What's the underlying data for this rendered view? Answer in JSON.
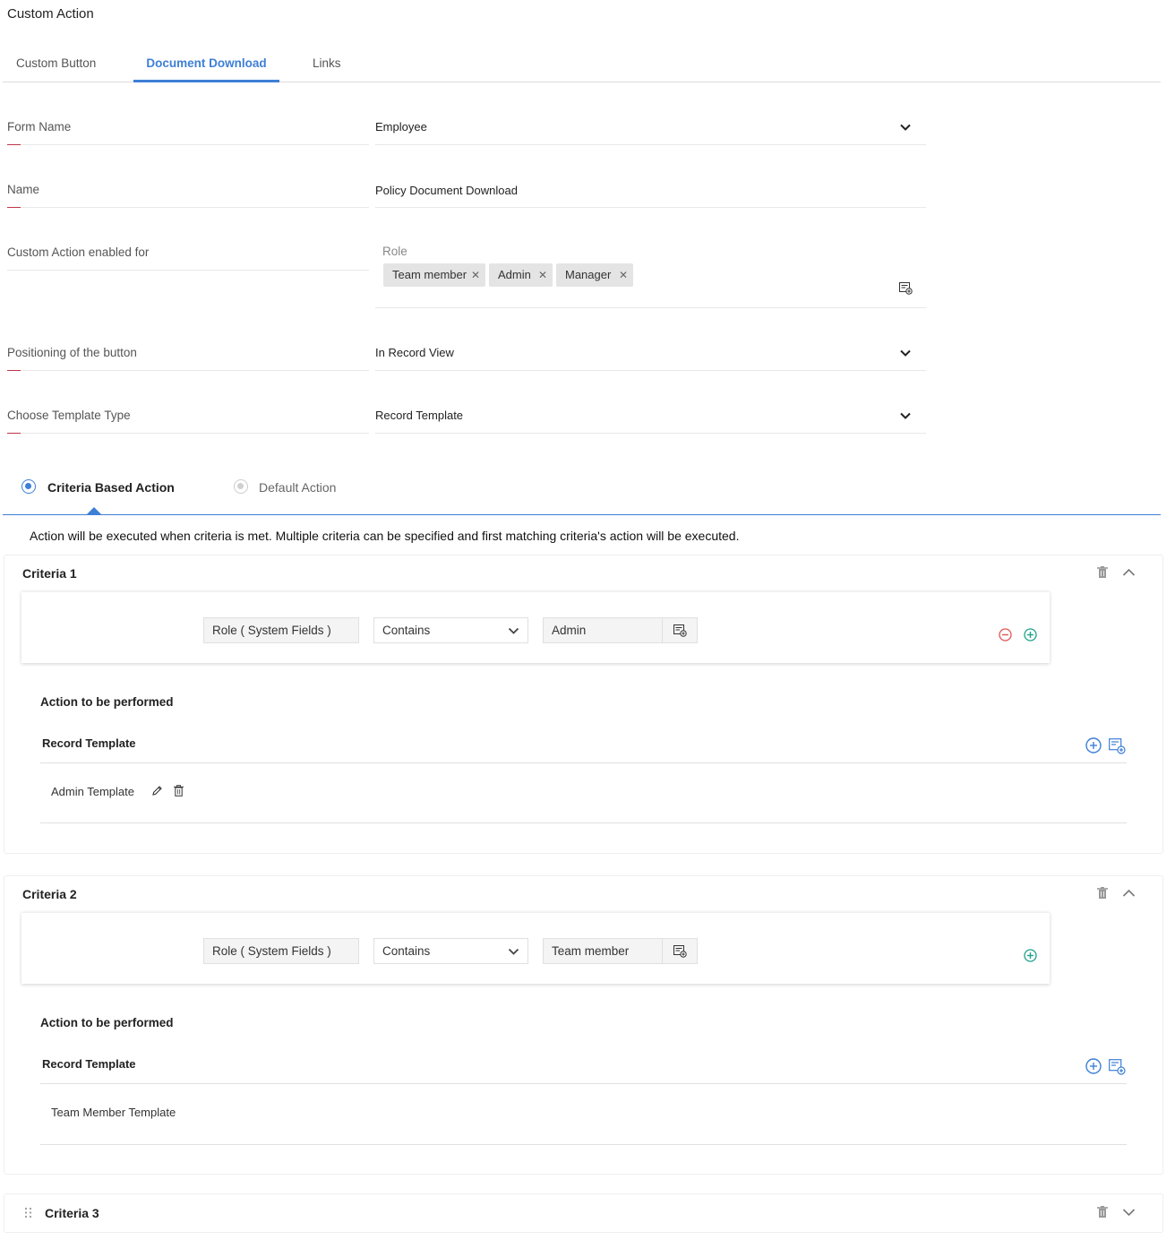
{
  "page": {
    "title": "Custom Action"
  },
  "tabs": [
    {
      "label": "Custom Button"
    },
    {
      "label": "Document Download"
    },
    {
      "label": "Links"
    }
  ],
  "form": {
    "form_name": {
      "label": "Form Name",
      "value": "Employee"
    },
    "name": {
      "label": "Name",
      "value": "Policy Document Download"
    },
    "enabled_for": {
      "label": "Custom Action enabled for",
      "sub_label": "Role",
      "chips": [
        "Team member",
        "Admin",
        "Manager"
      ]
    },
    "positioning": {
      "label": "Positioning of the button",
      "value": "In Record View"
    },
    "template_type": {
      "label": "Choose Template Type",
      "value": "Record Template"
    }
  },
  "action_mode": {
    "options": [
      {
        "label": "Criteria Based Action",
        "selected": true
      },
      {
        "label": "Default Action",
        "selected": false
      }
    ],
    "description": "Action will be executed when criteria is met. Multiple criteria can be specified and first matching criteria's action will be executed."
  },
  "criteria": [
    {
      "title": "Criteria 1",
      "field": "Role ( System Fields )",
      "operator": "Contains",
      "value": "Admin",
      "action_label": "Action to be performed",
      "template_type": "Record Template",
      "template_name": "Admin Template"
    },
    {
      "title": "Criteria 2",
      "field": "Role ( System Fields )",
      "operator": "Contains",
      "value": "Team member",
      "action_label": "Action to be performed",
      "template_type": "Record Template",
      "template_name": "Team Member Template"
    },
    {
      "title": "Criteria 3"
    }
  ],
  "colors": {
    "accent": "#3d7fd6",
    "required": "#c0344a",
    "remove": "#e05555",
    "add": "#1fa28a"
  }
}
